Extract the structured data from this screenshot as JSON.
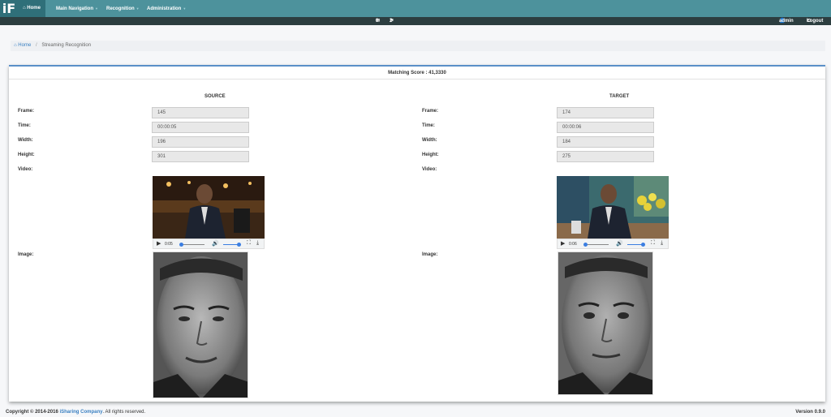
{
  "navbar": {
    "logo": "iF",
    "items": [
      {
        "label": "Home"
      },
      {
        "label": "Main Navigation"
      },
      {
        "label": "Recognition"
      },
      {
        "label": "Administration"
      }
    ],
    "messages_count": "0",
    "alerts_count": "2",
    "user": "admin",
    "logout": "Logout"
  },
  "breadcrumb": {
    "home": "Home",
    "current": "Streaming Recognition"
  },
  "panel": {
    "score": "Matching Score : 41,3330",
    "source": {
      "title": "SOURCE",
      "frame_label": "Frame:",
      "frame": "145",
      "time_label": "Time:",
      "time": "00:00:05",
      "width_label": "Width:",
      "width": "196",
      "height_label": "Height:",
      "height": "301",
      "video_label": "Video:",
      "video_time": "0:05",
      "image_label": "Image:"
    },
    "target": {
      "title": "TARGET",
      "frame_label": "Frame:",
      "frame": "174",
      "time_label": "Time:",
      "time": "00:00:06",
      "width_label": "Width:",
      "width": "184",
      "height_label": "Height:",
      "height": "275",
      "video_label": "Video:",
      "video_time": "0:06",
      "image_label": "Image:"
    }
  },
  "footer": {
    "copyright": "Copyright © 2014-2016",
    "company": "iSharing Company",
    "rights": ". All rights reserved.",
    "version": "Version 0.9.0"
  },
  "colors": {
    "navbar": "#4d929c",
    "navbar_active": "#2f6f79",
    "subbar": "#2c3e40",
    "link": "#3a80c2",
    "panel_accent": "#5a90c8"
  }
}
